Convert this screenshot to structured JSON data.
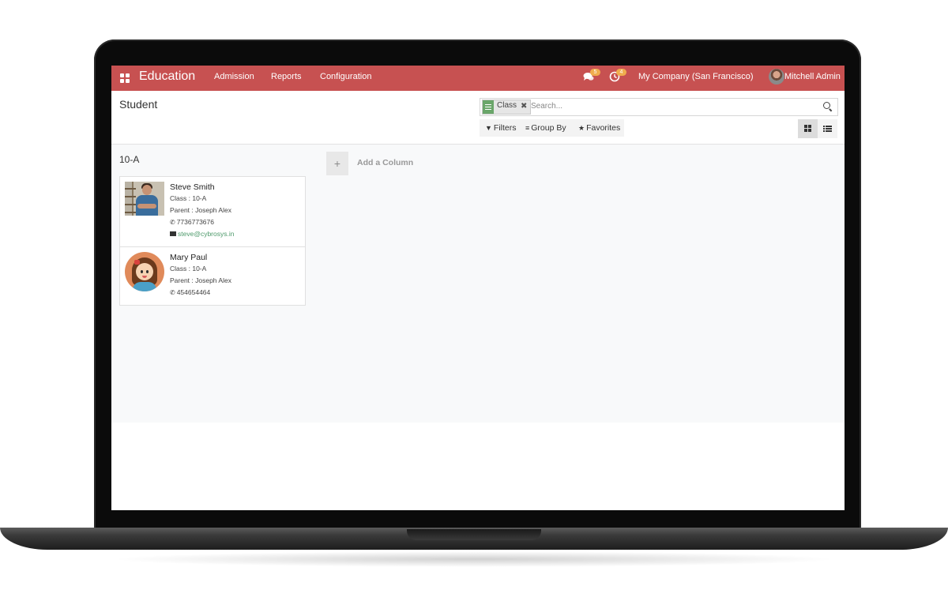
{
  "navbar": {
    "brand": "Education",
    "menu": [
      "Admission",
      "Reports",
      "Configuration"
    ],
    "messages_count": "5",
    "activities_count": "4",
    "company": "My Company (San Francisco)",
    "user": "Mitchell Admin",
    "color": "#c75151"
  },
  "control_panel": {
    "title": "Student",
    "facet_label": "Class",
    "search_placeholder": "Search...",
    "filters": "Filters",
    "group_by": "Group By",
    "favorites": "Favorites"
  },
  "kanban": {
    "column_title": "10-A",
    "add_column": "Add a Column",
    "cards": [
      {
        "name": "Steve Smith",
        "class": "Class : 10-A",
        "parent": "Parent : Joseph Alex",
        "phone": "7736773676",
        "email": "steve@cybrosys.in"
      },
      {
        "name": "Mary Paul",
        "class": "Class : 10-A",
        "parent": "Parent : Joseph Alex",
        "phone": "454654464"
      }
    ]
  }
}
